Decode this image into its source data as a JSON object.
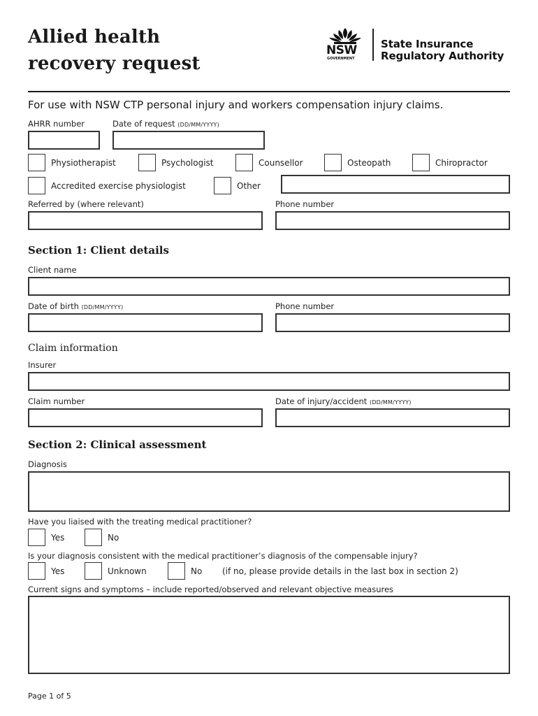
{
  "header": {
    "title_line1": "Allied health",
    "title_line2": "recovery request",
    "logo": {
      "emblem_icon": "waratah-flower-icon",
      "nsw": "NSW",
      "government": "GOVERNMENT",
      "org_line1": "State Insurance",
      "org_line2": "Regulatory Authority"
    }
  },
  "intro": "For use with NSW CTP personal injury and workers compensation injury claims.",
  "request": {
    "ahrr_label": "AHRR number",
    "ahrr_value": "",
    "date_label": "Date of request",
    "date_format": "(DD/MM/YYYY)",
    "date_value": "",
    "provider_types": [
      {
        "label": "Physiotherapist",
        "checked": false
      },
      {
        "label": "Psychologist",
        "checked": false
      },
      {
        "label": "Counsellor",
        "checked": false
      },
      {
        "label": "Osteopath",
        "checked": false
      },
      {
        "label": "Chiropractor",
        "checked": false
      },
      {
        "label": "Accredited exercise physiologist",
        "checked": false
      },
      {
        "label": "Other",
        "checked": false
      }
    ],
    "other_value": "",
    "referred_by_label": "Referred by (where relevant)",
    "referred_by_value": "",
    "phone_label": "Phone number",
    "phone_value": ""
  },
  "section1": {
    "heading": "Section 1: Client details",
    "client_name_label": "Client name",
    "client_name_value": "",
    "dob_label": "Date of birth",
    "dob_format": "(DD/MM/YYYY)",
    "dob_value": "",
    "phone_label": "Phone number",
    "phone_value": "",
    "claim_heading": "Claim information",
    "insurer_label": "Insurer",
    "insurer_value": "",
    "claim_number_label": "Claim number",
    "claim_number_value": "",
    "injury_date_label": "Date of injury/accident",
    "injury_date_format": "(DD/MM/YYYY)",
    "injury_date_value": ""
  },
  "section2": {
    "heading": "Section 2: Clinical assessment",
    "diagnosis_label": "Diagnosis",
    "diagnosis_value": "",
    "liaised_question": "Have you liaised with the treating medical practitioner?",
    "liaised_options": [
      {
        "label": "Yes",
        "checked": false
      },
      {
        "label": "No",
        "checked": false
      }
    ],
    "consistent_question": "Is your diagnosis consistent with the medical practitioner’s diagnosis of the compensable injury?",
    "consistent_options": [
      {
        "label": "Yes",
        "checked": false
      },
      {
        "label": "Unknown",
        "checked": false
      },
      {
        "label": "No",
        "checked": false
      }
    ],
    "consistent_note": "(if no, please provide details in the last box in section 2)",
    "symptoms_label": "Current signs and symptoms – include reported/observed and relevant objective measures",
    "symptoms_value": ""
  },
  "footer": {
    "page_label": "Page 1 of 5"
  }
}
